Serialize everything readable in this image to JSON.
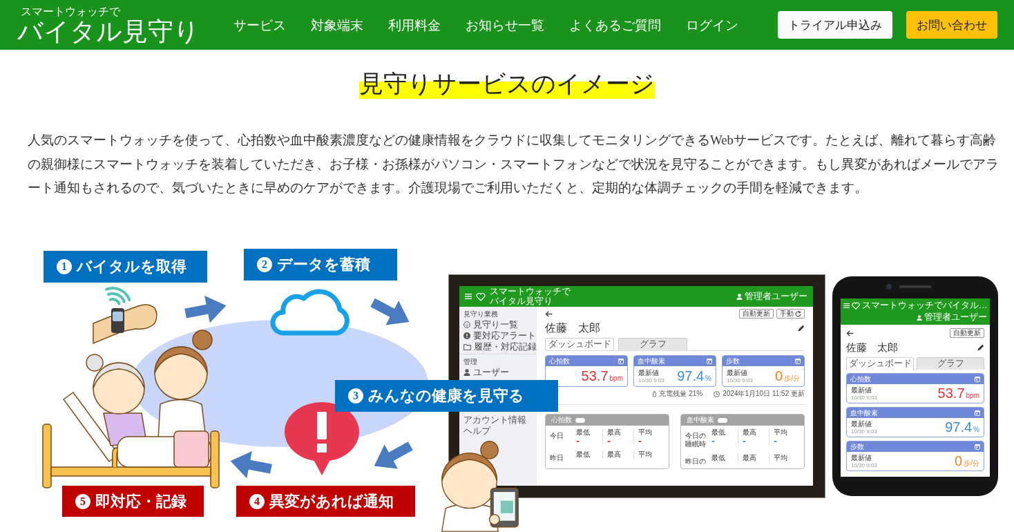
{
  "header": {
    "logo": {
      "tagline": "スマートウォッチで",
      "name": "バイタル見守り"
    },
    "nav": [
      "サービス",
      "対象端末",
      "利用料金",
      "お知らせ一覧",
      "よくあるご質問",
      "ログイン"
    ],
    "buttons": [
      {
        "label": "トライアル申込み",
        "kind": "light"
      },
      {
        "label": "お問い合わせ",
        "kind": "accent"
      }
    ]
  },
  "section": {
    "title": "見守りサービスのイメージ",
    "description": "人気のスマートウォッチを使って、心拍数や血中酸素濃度などの健康情報をクラウドに収集してモニタリングできるWebサービスです。たとえば、離れて暮らす高齢の親御様にスマートウォッチを装着していただき、お子様・お孫様がパソコン・スマートフォンなどで状況を見守ることができます。もし異変があればメールでアラート通知もされるので、気づいたときに早めのケアができます。介護現場でご利用いただくと、定期的な体調チェックの手間を軽減できます。"
  },
  "illustration": {
    "steps": [
      {
        "number": "1",
        "label": "バイタルを取得",
        "color": "#0070c0"
      },
      {
        "number": "2",
        "label": "データを蓄積",
        "color": "#0070c0"
      },
      {
        "number": "3",
        "label": "みんなの健康を見守る",
        "color": "#0070c0"
      },
      {
        "number": "5",
        "label": "即対応・記録",
        "color": "#c00000"
      },
      {
        "number": "4",
        "label": "異変があれば通知",
        "color": "#c00000"
      }
    ],
    "tablet": {
      "app_bar": {
        "tagline": "スマートウォッチで",
        "name": "バイタル見守り",
        "user": "管理者ユーザー"
      },
      "sidebar": {
        "groups": [
          {
            "heading": "見守り業務",
            "items": [
              "見守り一覧",
              "要対応アラート",
              "履歴・対応記録"
            ]
          },
          {
            "heading": "管理",
            "items": [
              "ユーザー"
            ]
          }
        ],
        "links": [
          "アカウント情報",
          "ヘルプ"
        ]
      },
      "buttons": [
        {
          "label": "自動更新",
          "kind": "plain"
        },
        {
          "label": "手動",
          "kind": "refresh"
        }
      ],
      "patient_name": "佐藤　太郎",
      "tabs": [
        {
          "label": "ダッシュボード",
          "selected": true
        },
        {
          "label": "グラフ",
          "selected": false
        }
      ],
      "metrics": [
        {
          "title": "心拍数",
          "value": "53.7",
          "unit": "bpm",
          "color": "#e5323e"
        },
        {
          "title": "血中酸素",
          "caption": "最新値",
          "time": "10/30 9:03",
          "value": "97.4",
          "unit": "%",
          "color": "#3b8ed6"
        },
        {
          "title": "歩数",
          "caption": "最新値",
          "time": "10/30 9:03",
          "value": "0",
          "unit": "歩/分",
          "color": "#f5841f"
        }
      ],
      "status": {
        "battery": "充電残量 21%",
        "updated": "2024年1月10日 11:52 更新"
      },
      "stats": [
        {
          "title": "心拍数",
          "color": "#e5323e",
          "rows": [
            {
              "label": "今日",
              "cells": [
                {
                  "label": "最低",
                  "value": "-"
                },
                {
                  "label": "最高",
                  "value": "-"
                },
                {
                  "label": "平均",
                  "value": "-"
                }
              ]
            },
            {
              "label": "昨日",
              "cells": [
                {
                  "label": "最低"
                },
                {
                  "label": "最高"
                },
                {
                  "label": "平均"
                }
              ]
            }
          ]
        },
        {
          "title": "血中酸素",
          "color": "#3b8ed6",
          "rows": [
            {
              "label": "今日の睡眠時",
              "cells": [
                {
                  "label": "最低",
                  "value": "-"
                },
                {
                  "label": "最高",
                  "value": "-"
                },
                {
                  "label": "平均",
                  "value": "-"
                }
              ]
            },
            {
              "label": "昨日の",
              "cells": [
                {
                  "label": "最低"
                },
                {
                  "label": "最高"
                },
                {
                  "label": "平均"
                }
              ]
            }
          ]
        }
      ]
    },
    "phone": {
      "app_bar": {
        "title": "スマートウォッチでバイタル…",
        "user": "管理者ユーザー"
      },
      "buttons": [
        {
          "label": "自動更新",
          "kind": "plain"
        }
      ],
      "patient_name": "佐藤　太郎",
      "tabs": [
        {
          "label": "ダッシュボード",
          "selected": true
        },
        {
          "label": "グラフ",
          "selected": false
        }
      ],
      "metrics": [
        {
          "title": "心拍数",
          "caption": "最新値",
          "time": "10/30 9:03",
          "value": "53.7",
          "unit": "bpm",
          "color": "#e5323e"
        },
        {
          "title": "血中酸素",
          "caption": "最新値",
          "time": "10/30 9:03",
          "value": "97.4",
          "unit": "%",
          "color": "#3b8ed6"
        },
        {
          "title": "歩数",
          "caption": "最新値",
          "time": "10/30 9:03",
          "value": "0",
          "unit": "歩/分",
          "color": "#f5841f"
        }
      ]
    }
  }
}
